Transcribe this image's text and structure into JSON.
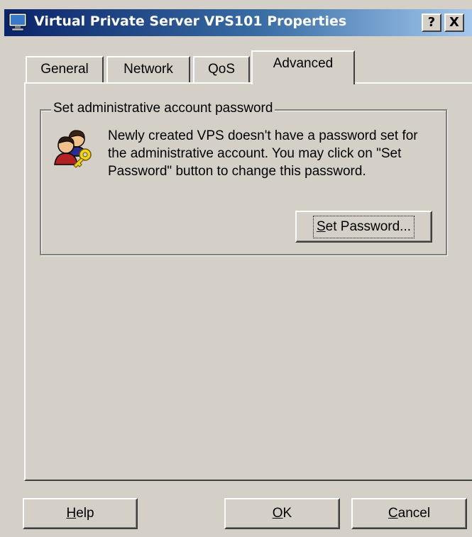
{
  "window": {
    "title": "Virtual Private Server VPS101 Properties",
    "help_button": "?",
    "close_button": "X"
  },
  "tabs": [
    {
      "label": "General",
      "selected": false
    },
    {
      "label": "Network",
      "selected": false
    },
    {
      "label": "QoS",
      "selected": false
    },
    {
      "label": "Advanced",
      "selected": true
    }
  ],
  "group": {
    "title": "Set administrative account password",
    "description": "Newly created VPS doesn't have a password set for the administrative account. You may click on \"Set Password\" button to change this password.",
    "set_password": {
      "accel": "S",
      "rest": "et Password..."
    }
  },
  "footer": {
    "help": {
      "accel": "H",
      "rest": "elp"
    },
    "ok": {
      "accel": "O",
      "rest": "K"
    },
    "cancel": {
      "accel": "C",
      "rest": "ancel"
    }
  },
  "icons": {
    "title": "server-icon",
    "group": "users-key-icon"
  },
  "colors": {
    "face": "#d4d0c8",
    "titlebar_start": "#0a246a",
    "titlebar_end": "#a6caf0"
  }
}
